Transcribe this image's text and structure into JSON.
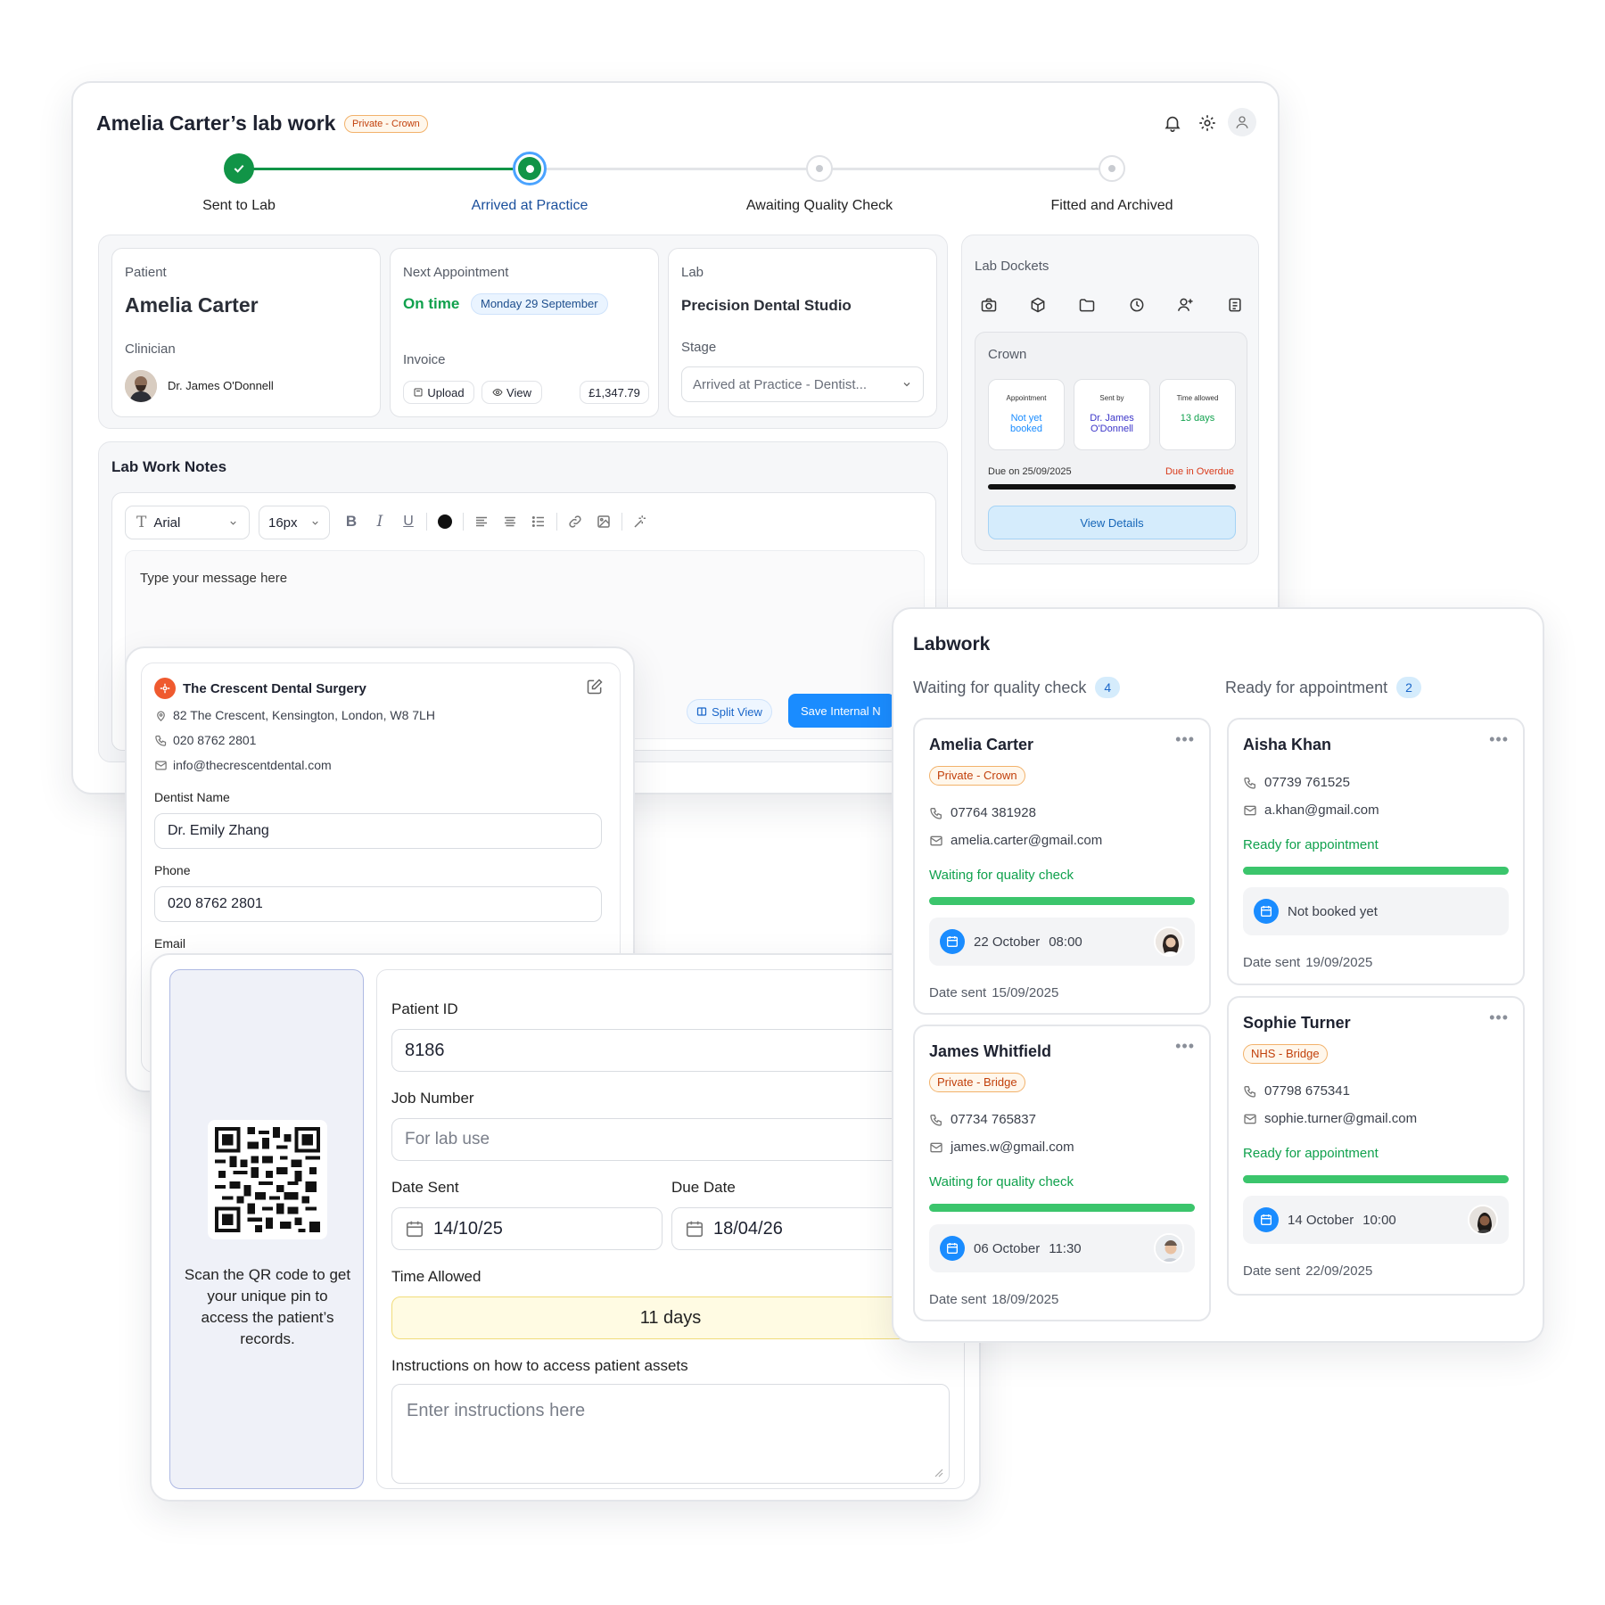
{
  "header": {
    "title": "Amelia Carter’s lab work",
    "badge": "Private - Crown"
  },
  "stepper": {
    "steps": [
      {
        "label": "Sent to Lab",
        "state": "done"
      },
      {
        "label": "Arrived at Practice",
        "state": "current"
      },
      {
        "label": "Awaiting Quality Check",
        "state": "pending"
      },
      {
        "label": "Fitted and Archived",
        "state": "pending"
      }
    ]
  },
  "patient": {
    "label": "Patient",
    "name": "Amelia Carter",
    "clinician_label": "Clinician",
    "clinician": "Dr. James O'Donnell"
  },
  "appointment": {
    "label": "Next Appointment",
    "status": "On time",
    "date": "Monday 29 September",
    "invoice_label": "Invoice",
    "upload": "Upload",
    "view": "View",
    "amount": "£1,347.79"
  },
  "lab": {
    "label": "Lab",
    "name": "Precision Dental Studio",
    "stage_label": "Stage",
    "stage_value": "Arrived at Practice - Dentist..."
  },
  "dockets": {
    "title": "Lab Dockets",
    "icons": [
      "camera-icon",
      "box-icon",
      "folder-icon",
      "clock-icon",
      "user-plus-icon",
      "notes-icon"
    ],
    "crown": {
      "title": "Crown",
      "tiles": [
        {
          "label": "Appointment",
          "value": "Not yet booked"
        },
        {
          "label": "Sent by",
          "value": "Dr. James O'Donnell"
        },
        {
          "label": "Time allowed",
          "value": "13 days"
        }
      ],
      "due": "Due on 25/09/2025",
      "overdue": "Due in Overdue",
      "button": "View Details"
    }
  },
  "notes": {
    "title": "Lab Work Notes",
    "font": "Arial",
    "size": "16px",
    "placeholder": "Type your message here",
    "split_view": "Split View",
    "save": "Save Internal N"
  },
  "surgery": {
    "name": "The Crescent Dental Surgery",
    "address": "82 The Crescent, Kensington, London, W8 7LH",
    "phone": "020 8762 2801",
    "email": "info@thecrescentdental.com",
    "dentist_label": "Dentist Name",
    "dentist_value": "Dr. Emily Zhang",
    "phone_label": "Phone",
    "phone_value": "020 8762 2801",
    "email_label": "Email"
  },
  "docket_form": {
    "qr_text": "Scan the QR code to get your unique pin to access the patient’s records.",
    "patient_id_label": "Patient ID",
    "patient_id": "8186",
    "job_label": "Job Number",
    "job_placeholder": "For lab use",
    "date_sent_label": "Date Sent",
    "date_sent": "14/10/25",
    "due_label": "Due Date",
    "due": "18/04/26",
    "time_label": "Time Allowed",
    "time_value": "11 days",
    "instructions_label": "Instructions on how to access patient assets",
    "instructions_placeholder": "Enter instructions here"
  },
  "labwork": {
    "title": "Labwork",
    "col1": {
      "title": "Waiting for quality check",
      "count": "4",
      "cards": [
        {
          "name": "Amelia Carter",
          "tag": "Private - Crown",
          "phone": "07764 381928",
          "email": "amelia.carter@gmail.com",
          "status": "Waiting for quality check",
          "appt_date": "22 October",
          "appt_time": "08:00",
          "sent": "Date sent",
          "sent_date": "15/09/2025"
        },
        {
          "name": "James Whitfield",
          "tag": "Private - Bridge",
          "phone": "07734 765837",
          "email": "james.w@gmail.com",
          "status": "Waiting for quality check",
          "appt_date": "06 October",
          "appt_time": "11:30",
          "sent": "Date sent",
          "sent_date": "18/09/2025"
        }
      ]
    },
    "col2": {
      "title": "Ready for appointment",
      "count": "2",
      "cards": [
        {
          "name": "Aisha Khan",
          "phone": "07739 761525",
          "email": "a.khan@gmail.com",
          "status": "Ready for appointment",
          "appt_text": "Not booked yet",
          "sent": "Date sent",
          "sent_date": "19/09/2025"
        },
        {
          "name": "Sophie Turner",
          "tag": "NHS - Bridge",
          "phone": "07798 675341",
          "email": "sophie.turner@gmail.com",
          "status": "Ready for appointment",
          "appt_date": "14 October",
          "appt_time": "10:00",
          "sent": "Date sent",
          "sent_date": "22/09/2025"
        }
      ]
    }
  },
  "colors": {
    "accent_blue": "#1a8cff",
    "success_green": "#10a14d",
    "step_green": "#119447",
    "badge_orange": "#c2410c",
    "overdue_red": "#d93a1a"
  }
}
